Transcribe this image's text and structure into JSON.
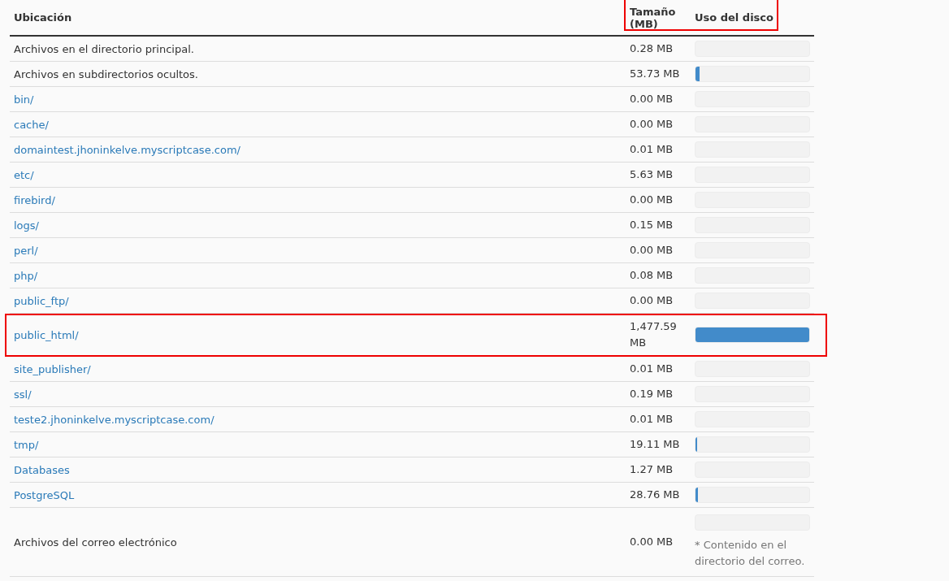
{
  "table": {
    "columns": [
      {
        "label": "Ubicación",
        "highlighted": false
      },
      {
        "label": "Tamaño (MB)",
        "highlighted": true
      },
      {
        "label": "Uso del disco",
        "highlighted": true
      }
    ],
    "rows": [
      {
        "location": "Archivos en el directorio principal.",
        "kind": "text",
        "size": "0.28 MB",
        "level": 0,
        "highlighted": false
      },
      {
        "location": "Archivos en subdirectorios ocultos.",
        "kind": "text",
        "size": "53.73 MB",
        "level": 0.036,
        "highlighted": false
      },
      {
        "location": "bin/",
        "kind": "link",
        "size": "0.00 MB",
        "level": 0,
        "highlighted": false
      },
      {
        "location": "cache/",
        "kind": "link",
        "size": "0.00 MB",
        "level": 0,
        "highlighted": false
      },
      {
        "location": "domaintest.jhoninkelve.myscriptcase.com/",
        "kind": "link",
        "size": "0.01 MB",
        "level": 0,
        "highlighted": false
      },
      {
        "location": "etc/",
        "kind": "link",
        "size": "5.63 MB",
        "level": 0,
        "highlighted": false
      },
      {
        "location": "firebird/",
        "kind": "link",
        "size": "0.00 MB",
        "level": 0,
        "highlighted": false
      },
      {
        "location": "logs/",
        "kind": "link",
        "size": "0.15 MB",
        "level": 0,
        "highlighted": false
      },
      {
        "location": "perl/",
        "kind": "link",
        "size": "0.00 MB",
        "level": 0,
        "highlighted": false
      },
      {
        "location": "php/",
        "kind": "link",
        "size": "0.08 MB",
        "level": 0,
        "highlighted": false
      },
      {
        "location": "public_ftp/",
        "kind": "link",
        "size": "0.00 MB",
        "level": 0,
        "highlighted": false
      },
      {
        "location": "public_html/",
        "kind": "link",
        "size": "1,477.59 MB",
        "level": 1,
        "highlighted": true
      },
      {
        "location": "site_publisher/",
        "kind": "link",
        "size": "0.01 MB",
        "level": 0,
        "highlighted": false
      },
      {
        "location": "ssl/",
        "kind": "link",
        "size": "0.19 MB",
        "level": 0,
        "highlighted": false
      },
      {
        "location": "teste2.jhoninkelve.myscriptcase.com/",
        "kind": "link",
        "size": "0.01 MB",
        "level": 0,
        "highlighted": false
      },
      {
        "location": "tmp/",
        "kind": "link",
        "size": "19.11 MB",
        "level": 0.013,
        "highlighted": false
      },
      {
        "location": "Databases",
        "kind": "link",
        "size": "1.27 MB",
        "level": 0,
        "highlighted": false
      },
      {
        "location": "PostgreSQL",
        "kind": "link",
        "size": "28.76 MB",
        "level": 0.019,
        "highlighted": false
      },
      {
        "location": "Archivos del correo electrónico",
        "kind": "text",
        "size": "0.00 MB",
        "level": 0,
        "highlighted": false,
        "note": "* Contenido en el directorio del correo."
      }
    ]
  }
}
